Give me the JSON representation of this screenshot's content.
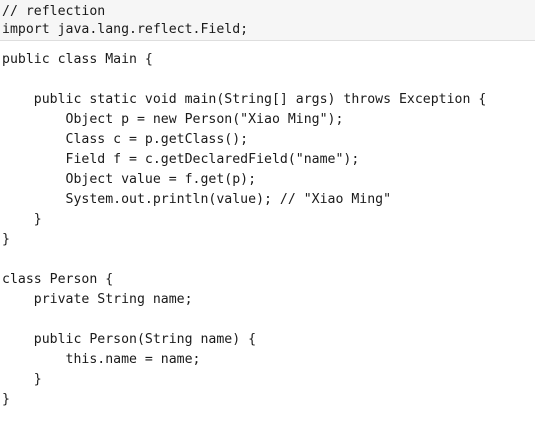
{
  "header_lines": [
    "// reflection",
    "import java.lang.reflect.Field;"
  ],
  "code_lines": [
    "public class Main {",
    "",
    "    public static void main(String[] args) throws Exception {",
    "        Object p = new Person(\"Xiao Ming\");",
    "        Class c = p.getClass();",
    "        Field f = c.getDeclaredField(\"name\");",
    "        Object value = f.get(p);",
    "        System.out.println(value); // \"Xiao Ming\"",
    "    }",
    "}",
    "",
    "class Person {",
    "    private String name;",
    "",
    "    public Person(String name) {",
    "        this.name = name;",
    "    }",
    "}"
  ]
}
